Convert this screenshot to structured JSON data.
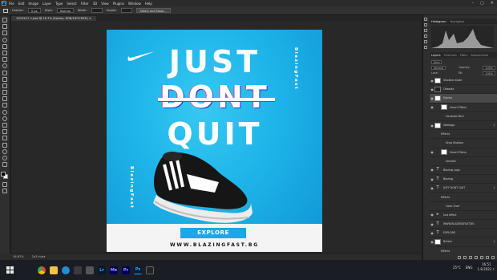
{
  "menubar": {
    "items": [
      "File",
      "Edit",
      "Image",
      "Layer",
      "Type",
      "Select",
      "Filter",
      "3D",
      "View",
      "Plugins",
      "Window",
      "Help"
    ]
  },
  "options": {
    "feather_label": "Feather:",
    "feather_value": "0 px",
    "style_label": "Style:",
    "style_value": "Normal",
    "width_label": "Width:",
    "height_label": "Height:",
    "select_mask_button": "Select and Mask..."
  },
  "document": {
    "tab_title": "1SC9X17-1.psd @ 16.7% (Ejonka, RGB/16*/CMYK)"
  },
  "poster": {
    "line1": "JUST",
    "line2": "DONT",
    "line3": "QUIT",
    "vertical_right": "BlazingFast",
    "vertical_left": "BlazingFast",
    "button": "EXPLORE",
    "url": "WWW.BLAZINGFAST.BG",
    "colors": {
      "bg": "#1eb3e8",
      "button": "#1aa9e3",
      "bottom": "#f4f4f4"
    }
  },
  "panels": {
    "top_tabs": [
      "Histogram",
      "Navigator"
    ],
    "layer_tabs": [
      "Layers",
      "Channels",
      "Paths",
      "Adjustments"
    ],
    "kind_label": "Kind",
    "blend_mode": "Normal",
    "opacity_label": "Opacity:",
    "opacity_value": "100%",
    "lock_label": "Lock:",
    "fill_label": "Fill:",
    "fill_value": "100%"
  },
  "layers": [
    {
      "name": "Shadow mode",
      "type": "pixel",
      "indent": 0
    },
    {
      "name": "Obsedia",
      "type": "dark",
      "indent": 0
    },
    {
      "name": "Ejonka",
      "type": "pixel",
      "indent": 0,
      "active": true
    },
    {
      "name": "Smart Filters",
      "type": "pixel",
      "indent": 1
    },
    {
      "name": "Gaussian Blur",
      "type": "none",
      "indent": 2
    },
    {
      "name": "ideologo",
      "type": "pixel",
      "indent": 0,
      "fx": true
    },
    {
      "name": "Effects",
      "type": "none",
      "indent": 1
    },
    {
      "name": "Drop Shadow",
      "type": "none",
      "indent": 2
    },
    {
      "name": "Smart Filters",
      "type": "pixel",
      "indent": 1
    },
    {
      "name": "Smooth",
      "type": "none",
      "indent": 2
    },
    {
      "name": "Blazing copy",
      "type": "text",
      "indent": 0
    },
    {
      "name": "Blazing",
      "type": "text",
      "indent": 0
    },
    {
      "name": "JUST DONT QUIT",
      "type": "text",
      "indent": 0,
      "fx": true
    },
    {
      "name": "Effects",
      "type": "none",
      "indent": 1
    },
    {
      "name": "Color Over",
      "type": "none",
      "indent": 2
    },
    {
      "name": "Just effect",
      "type": "folder",
      "indent": 0
    },
    {
      "name": "WWW.BLAZINGFAST.BG",
      "type": "text",
      "indent": 0
    },
    {
      "name": "EXPLORE",
      "type": "text",
      "indent": 0
    },
    {
      "name": "Button",
      "type": "pixel",
      "indent": 0,
      "fx": true
    },
    {
      "name": "Effects",
      "type": "none",
      "indent": 1
    }
  ],
  "status": {
    "zoom": "16.67%",
    "doc": "2x3 in/ea"
  },
  "taskbar": {
    "weather": "25°C",
    "time": "16:51",
    "date": "1.8.2021 г.",
    "lang": "ENG"
  }
}
